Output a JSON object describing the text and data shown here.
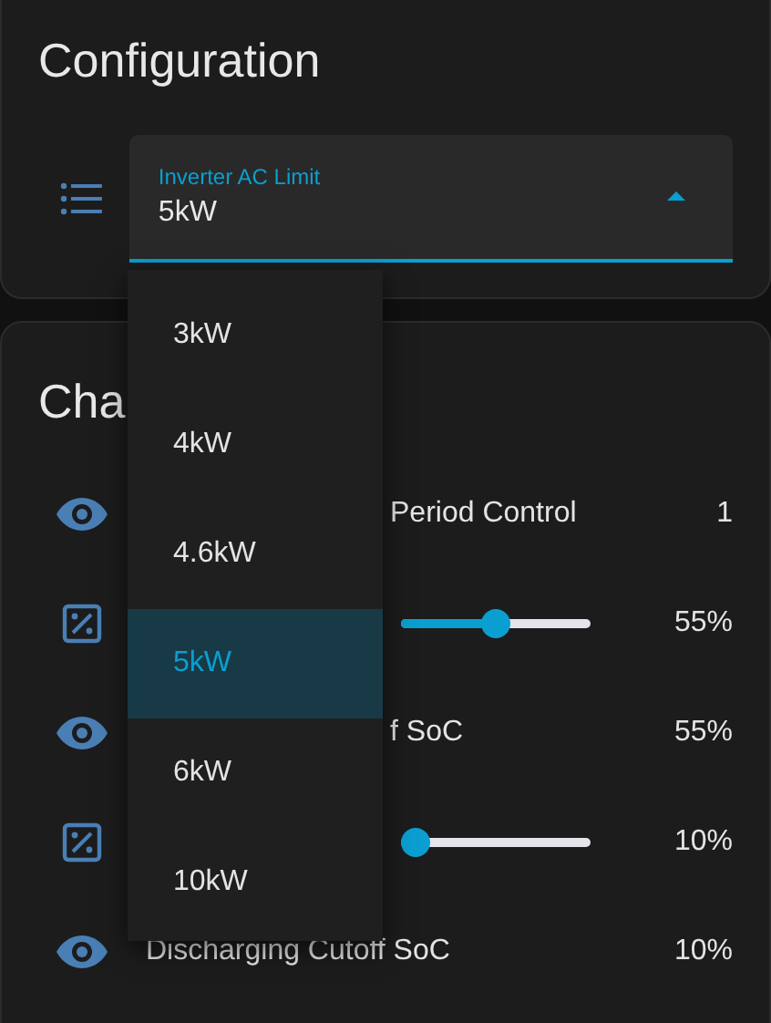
{
  "config_card": {
    "title": "Configuration",
    "select": {
      "label": "Inverter AC Limit",
      "value": "5kW",
      "expanded": true
    }
  },
  "menu": [
    {
      "label": "3kW",
      "selected": false
    },
    {
      "label": "4kW",
      "selected": false
    },
    {
      "label": "4.6kW",
      "selected": false
    },
    {
      "label": "5kW",
      "selected": true
    },
    {
      "label": "6kW",
      "selected": false
    },
    {
      "label": "10kW",
      "selected": false
    }
  ],
  "second_card": {
    "title": "Cha",
    "rows": [
      {
        "kind": "covered",
        "label": "Period Control",
        "value": "1"
      },
      {
        "kind": "slider",
        "level": 0.5,
        "value": "55%"
      },
      {
        "kind": "covered",
        "label": "f SoC",
        "value": "55%"
      },
      {
        "kind": "slider",
        "level": 0,
        "value": "10%"
      },
      {
        "kind": "entity",
        "label": "Discharging Cutoff SoC",
        "value": "10%"
      }
    ]
  }
}
